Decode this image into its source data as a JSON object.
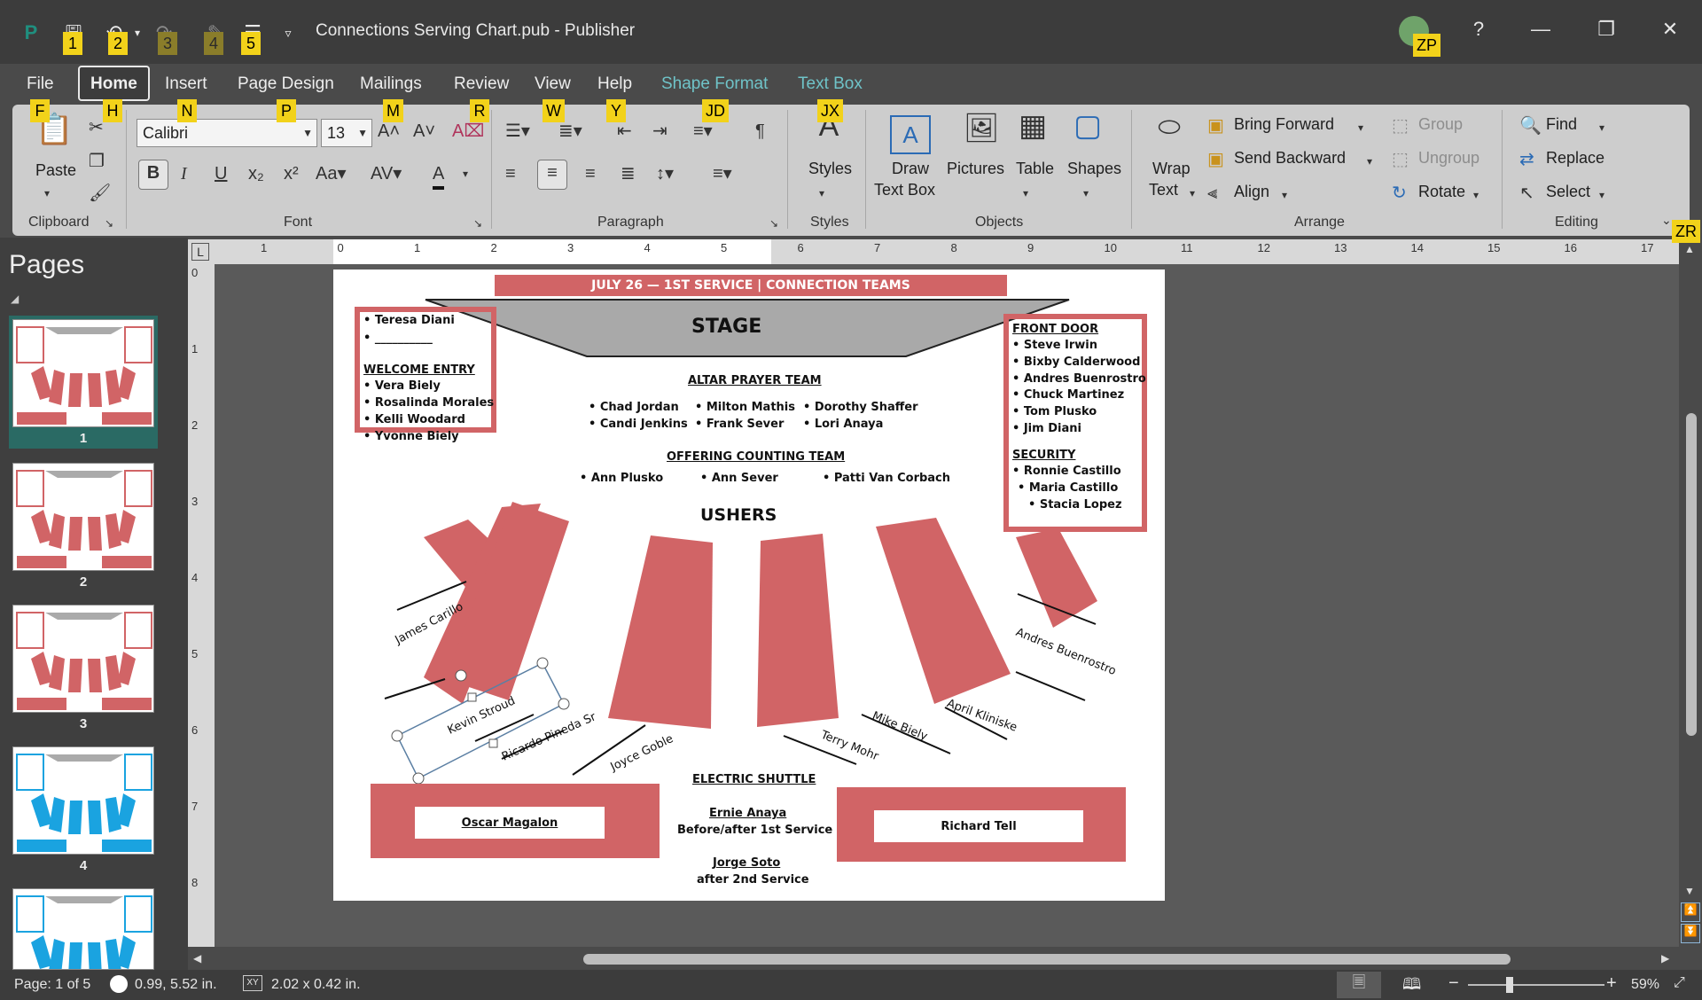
{
  "window": {
    "app_icon": "publisher-icon",
    "title": "Connections Serving Chart.pub  -  Publisher",
    "user_initials": "ZP",
    "help": "?",
    "keytips_qat": [
      "1",
      "2",
      "3",
      "4",
      "5"
    ],
    "keytip_account": "ZP",
    "keytip_collapse": "ZR"
  },
  "menu_tabs": [
    {
      "label": "File",
      "keytip": "F"
    },
    {
      "label": "Home",
      "keytip": "H"
    },
    {
      "label": "Insert",
      "keytip": "N"
    },
    {
      "label": "Page Design",
      "keytip": "P"
    },
    {
      "label": "Mailings",
      "keytip": "M"
    },
    {
      "label": "Review",
      "keytip": "R"
    },
    {
      "label": "View",
      "keytip": "W"
    },
    {
      "label": "Help",
      "keytip": "Y"
    },
    {
      "label": "Shape Format",
      "keytip": "JD"
    },
    {
      "label": "Text Box",
      "keytip": "JX"
    }
  ],
  "ribbon": {
    "clipboard": {
      "label": "Clipboard",
      "paste": "Paste"
    },
    "font": {
      "label": "Font",
      "font_name": "Calibri",
      "font_size": "13"
    },
    "paragraph": {
      "label": "Paragraph"
    },
    "styles": {
      "label": "Styles",
      "button": "Styles"
    },
    "objects": {
      "label": "Objects",
      "draw_text_box_1": "Draw",
      "draw_text_box_2": "Text Box",
      "pictures": "Pictures",
      "table": "Table",
      "shapes": "Shapes"
    },
    "arrange": {
      "label": "Arrange",
      "wrap_text_1": "Wrap",
      "wrap_text_2": "Text",
      "bring_forward": "Bring Forward",
      "send_backward": "Send Backward",
      "align": "Align",
      "group": "Group",
      "ungroup": "Ungroup",
      "rotate": "Rotate"
    },
    "editing": {
      "label": "Editing",
      "find": "Find",
      "replace": "Replace",
      "select": "Select"
    }
  },
  "pages_panel": {
    "title": "Pages",
    "pages": [
      "1",
      "2",
      "3",
      "4"
    ]
  },
  "rulers": {
    "h_ticks": [
      "1",
      "0",
      "1",
      "2",
      "3",
      "4",
      "5",
      "6",
      "7",
      "8",
      "9",
      "10",
      "11",
      "12",
      "13",
      "14",
      "15",
      "16",
      "17"
    ],
    "v_ticks": [
      "0",
      "1",
      "2",
      "3",
      "4",
      "5",
      "6",
      "7",
      "8"
    ]
  },
  "document": {
    "banner": "JULY 26 — 1ST SERVICE |  CONNECTION TEAMS",
    "stage": "STAGE",
    "left_box": {
      "items": [
        "• Teresa Diani",
        "• __________"
      ],
      "heading": "WELCOME ENTRY",
      "people": [
        "• Vera Biely",
        "• Rosalinda Morales",
        "• Kelli Woodard",
        "• Yvonne Biely"
      ]
    },
    "right_box": {
      "heading1": "FRONT DOOR",
      "people1": [
        "• Steve Irwin",
        "• Bixby Calderwood",
        "• Andres Buenrostro",
        "• Chuck Martinez",
        "• Tom Plusko",
        "• Jim Diani"
      ],
      "heading2": "SECURITY",
      "people2": [
        "• Ronnie Castillo",
        "• Maria Castillo",
        "• Stacia Lopez"
      ]
    },
    "altar": {
      "heading": "ALTAR PRAYER TEAM",
      "col1": [
        "• Chad Jordan",
        "• Candi Jenkins"
      ],
      "col2": [
        "• Milton Mathis",
        "• Frank Sever"
      ],
      "col3": [
        "• Dorothy Shaffer",
        "• Lori Anaya"
      ]
    },
    "offering": {
      "heading": "OFFERING COUNTING TEAM",
      "people": [
        "• Ann Plusko",
        "• Ann Sever",
        "• Patti Van Corbach"
      ]
    },
    "ushers": "USHERS",
    "usher_names": [
      "James Carillo",
      "Kevin Stroud",
      "Ricardo Pineda Sr",
      "Joyce Goble",
      "Terry Mohr",
      "Mike Biely",
      "April Kliniske",
      "Andres Buenrostro"
    ],
    "shuttle": {
      "heading": "ELECTRIC SHUTTLE",
      "name1": "Ernie Anaya",
      "line1": "Before/after 1st Service",
      "name2": "Jorge Soto",
      "line2": "after 2nd Service"
    },
    "left_footer": "Oscar Magalon",
    "right_footer": "Richard Tell"
  },
  "status": {
    "page": "Page: 1 of 5",
    "position": "0.99, 5.52 in.",
    "size": "2.02 x  0.42 in.",
    "zoom": "59%",
    "zoom_level_percent": 59
  }
}
